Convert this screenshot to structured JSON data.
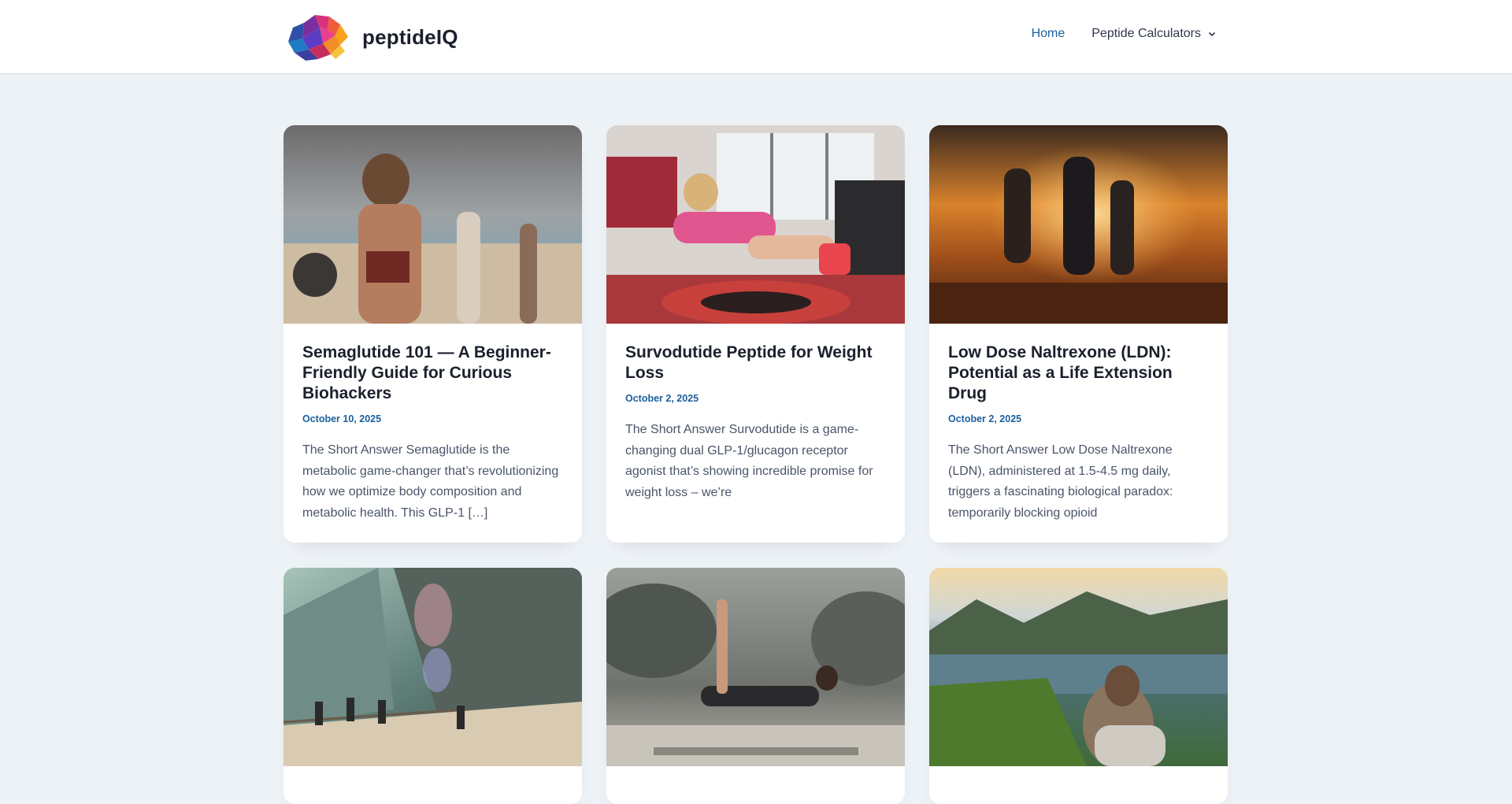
{
  "site": {
    "name": "peptideIQ",
    "logo_icon": "brain-logo-icon"
  },
  "nav": {
    "items": [
      {
        "label": "Home",
        "active": true
      },
      {
        "label": "Peptide Calculators",
        "has_dropdown": true,
        "icon": "chevron-down-icon"
      }
    ]
  },
  "posts": [
    {
      "title": "Semaglutide 101 — A Beginner-Friendly Guide for Curious Biohackers",
      "date": "October 10, 2025",
      "excerpt": "The Short Answer Semaglutide is the metabolic game-changer that’s revolutionizing how we optimize body composition and metabolic health. This GLP-1 […]",
      "image": "woman-walking-on-beach-with-yoga-mat"
    },
    {
      "title": "Survodutide Peptide for Weight Loss",
      "date": "October 2, 2025",
      "excerpt": "The Short Answer Survodutide is a game-changing dual GLP-1/glucagon receptor agonist that’s showing incredible promise for weight loss – we’re",
      "image": "woman-exercising-on-tire-in-gym"
    },
    {
      "title": "Low Dose Naltrexone (LDN): Potential as a Life Extension Drug",
      "date": "October 2, 2025",
      "excerpt": "The Short Answer Low Dose Naltrexone (LDN), administered at 1.5-4.5 mg daily, triggers a fascinating biological paradox: temporarily blocking opioid",
      "image": "friends-celebrating-at-sunset-on-hill"
    },
    {
      "title": "",
      "date": "",
      "excerpt": "",
      "image": "hikers-at-mountain-overlook"
    },
    {
      "title": "",
      "date": "",
      "excerpt": "",
      "image": "woman-doing-yoga-outdoors"
    },
    {
      "title": "",
      "date": "",
      "excerpt": "",
      "image": "man-overlooking-fjord-landscape"
    }
  ],
  "colors": {
    "accent": "#1a5f9e",
    "page_bg": "#edf2f7"
  }
}
